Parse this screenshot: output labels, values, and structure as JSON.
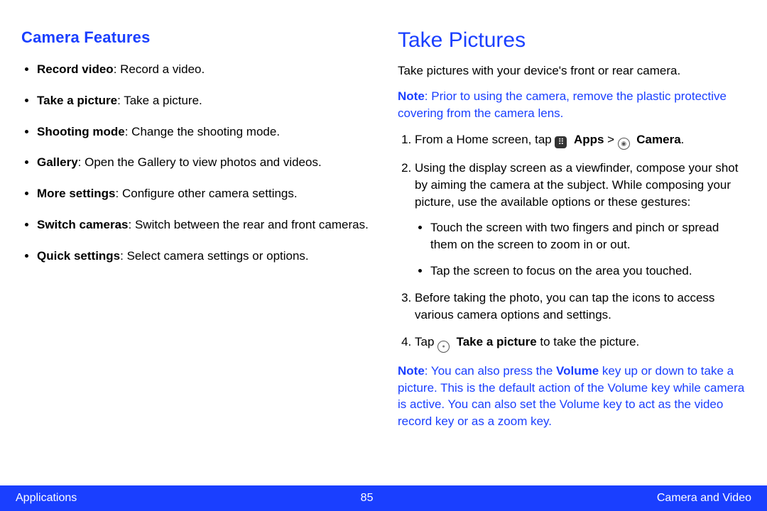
{
  "left": {
    "heading": "Camera Features",
    "items": [
      {
        "term": "Record video",
        "desc": ": Record a video."
      },
      {
        "term": "Take a picture",
        "desc": ": Take a picture."
      },
      {
        "term": "Shooting mode",
        "desc": ": Change the shooting mode."
      },
      {
        "term": "Gallery",
        "desc": ": Open the Gallery to view photos and videos."
      },
      {
        "term": "More settings",
        "desc": ": Configure other camera settings."
      },
      {
        "term": "Switch cameras",
        "desc": ": Switch between the rear and front cameras."
      },
      {
        "term": "Quick settings",
        "desc": ": Select camera settings or options."
      }
    ]
  },
  "right": {
    "heading": "Take Pictures",
    "intro": "Take pictures with your device's front or rear camera.",
    "note1_prefix": "Note",
    "note1_body": ": Prior to using the camera, remove the plastic protective covering from the camera lens.",
    "step1": {
      "pre": "From a Home screen, tap ",
      "apps": "Apps",
      "gt": " > ",
      "camera": "Camera",
      "post": "."
    },
    "step2": "Using the display screen as a viewfinder, compose your shot by aiming the camera at the subject. While composing your picture, use the available options or these gestures:",
    "sub1": "Touch the screen with two fingers and pinch or spread them on the screen to zoom in or out.",
    "sub2": "Tap the screen to focus on the area you touched.",
    "step3": "Before taking the photo, you can tap the icons to access various camera options and settings.",
    "step4": {
      "pre": "Tap ",
      "label": "Take a picture",
      "post": " to take the picture."
    },
    "note2_prefix": "Note",
    "note2_body_a": ": You can also press the ",
    "note2_volume": "Volume",
    "note2_body_b": " key up or down to take a picture. This is the default action of the Volume key while camera is active. You can also set the Volume key to act as the video record key or as a zoom key."
  },
  "footer": {
    "left": "Applications",
    "center": "85",
    "right": "Camera and Video"
  }
}
